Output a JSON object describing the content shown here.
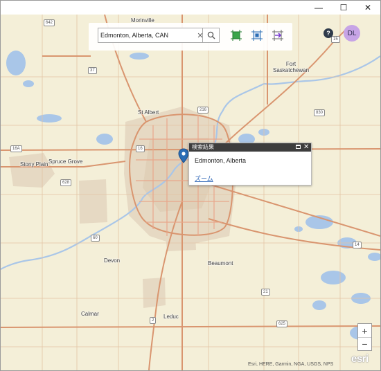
{
  "window": {
    "minimize_glyph": "—",
    "maximize_glyph": "☐",
    "close_glyph": "✕"
  },
  "search": {
    "value": "Edmonton, Alberta, CAN",
    "placeholder": "",
    "clear_glyph": "✕"
  },
  "toolbar": {
    "icons": [
      "search-icon",
      "rectangle-select-icon",
      "extent-select-icon",
      "pan-extent-icon"
    ]
  },
  "user": {
    "help_glyph": "?",
    "avatar_initials": "DL",
    "avatar_color": "#c7a4e6"
  },
  "popup": {
    "title": "検索結果",
    "body": "Edmonton, Alberta",
    "zoom_link": "ズーム"
  },
  "map": {
    "labels": {
      "morinville": "Morinville",
      "fort_saskatchewan": "Fort\nSaskatchewan",
      "st_albert": "St Albert",
      "spruce_grove": "Spruce Grove",
      "stony_plain": "Stony Plain",
      "devon": "Devon",
      "beaumont": "Beaumont",
      "calmar": "Calmar",
      "leduc": "Leduc"
    },
    "shields": {
      "s642": "642",
      "s15": "15",
      "s37": "37",
      "s216a": "216",
      "s830": "830",
      "s16": "16",
      "s16a": "16A",
      "s628": "628",
      "s60": "60",
      "s14": "14",
      "s21": "21",
      "s625": "625",
      "s2": "2"
    },
    "colors": {
      "land": "#f4efd8",
      "water": "#a9c6e8",
      "highway": "#d9956f",
      "urban": "#e4d7c2"
    }
  },
  "zoom": {
    "in_label": "+",
    "out_label": "−"
  },
  "attribution": "Esri, HERE, Garmin, NGA, USGS, NPS",
  "logo": "esri"
}
